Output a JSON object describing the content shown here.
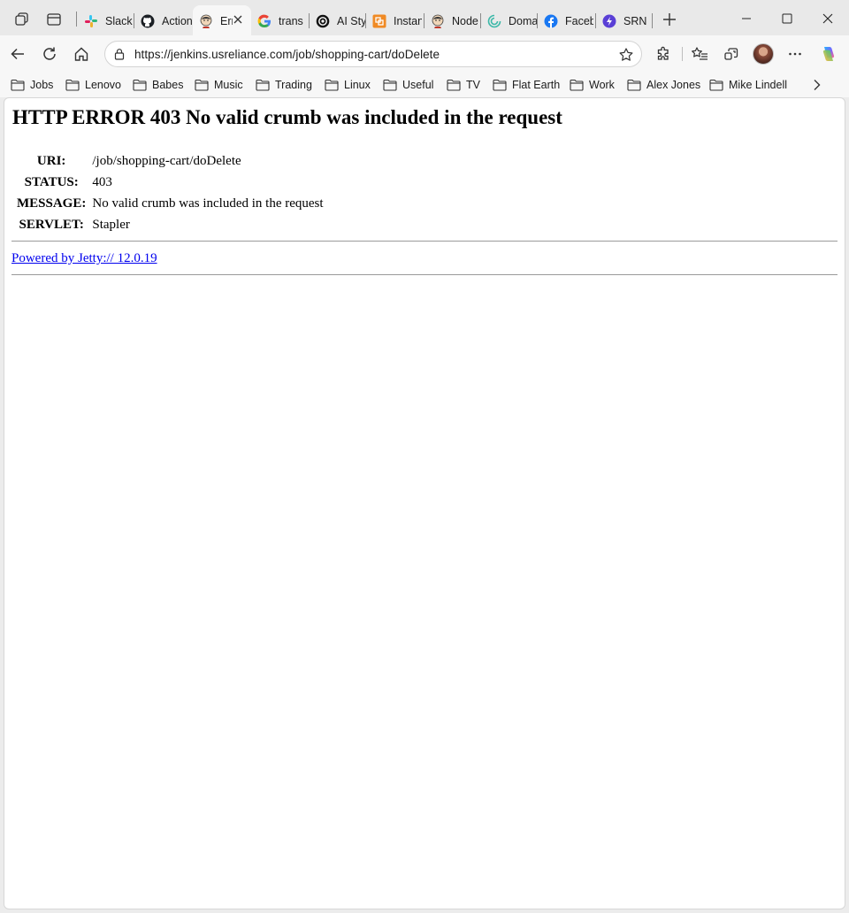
{
  "tabs": [
    {
      "label": "Slack",
      "icon": "slack-icon"
    },
    {
      "label": "Actions",
      "icon": "github-icon"
    },
    {
      "label": "Error",
      "icon": "jenkins-icon",
      "active": true
    },
    {
      "label": "translate",
      "icon": "google-icon"
    },
    {
      "label": "AI Style",
      "icon": "openai-icon"
    },
    {
      "label": "Instance",
      "icon": "orange-app-icon"
    },
    {
      "label": "Node",
      "icon": "jenkins-icon"
    },
    {
      "label": "Domain",
      "icon": "teal-swirl-icon"
    },
    {
      "label": "Facebook",
      "icon": "facebook-icon"
    },
    {
      "label": "SRN",
      "icon": "purple-bolt-icon"
    }
  ],
  "address": {
    "url": "https://jenkins.usreliance.com/job/shopping-cart/doDelete"
  },
  "bookmarks": [
    {
      "label": "Jobs"
    },
    {
      "label": "Lenovo"
    },
    {
      "label": "Babes"
    },
    {
      "label": "Music"
    },
    {
      "label": "Trading"
    },
    {
      "label": "Linux"
    },
    {
      "label": "Useful"
    },
    {
      "label": "TV"
    },
    {
      "label": "Flat Earth"
    },
    {
      "label": "Work"
    },
    {
      "label": "Alex Jones"
    },
    {
      "label": "Mike Lindell"
    }
  ],
  "error_page": {
    "heading": "HTTP ERROR 403 No valid crumb was included in the request",
    "rows": [
      {
        "key": "URI:",
        "value": "/job/shopping-cart/doDelete"
      },
      {
        "key": "STATUS:",
        "value": "403"
      },
      {
        "key": "MESSAGE:",
        "value": "No valid crumb was included in the request"
      },
      {
        "key": "SERVLET:",
        "value": "Stapler"
      }
    ],
    "powered_by": "Powered by Jetty:// 12.0.19"
  },
  "colors": {
    "link": "#0000ee",
    "copilot": "#7b61ff"
  }
}
